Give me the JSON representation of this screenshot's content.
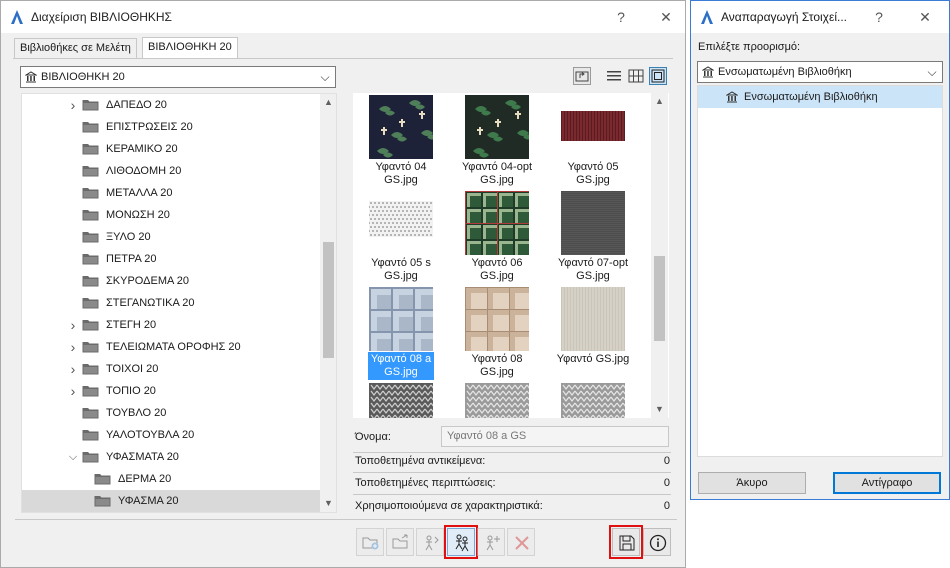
{
  "main_window": {
    "title": "Διαχείριση ΒΙΒΛΙΟΘΗΚΗΣ",
    "help_glyph": "?",
    "close_glyph": "✕",
    "tabs": [
      {
        "label": "Βιβλιοθήκες σε Μελέτη",
        "active": false
      },
      {
        "label": "ΒΙΒΛΙΟΘΗΚΗ 20",
        "active": true
      }
    ],
    "library_select": {
      "value": "ΒΙΒΛΙΟΘΗΚΗ 20",
      "icon": "library-icon"
    },
    "view_buttons": [
      "up-folder-icon",
      "list-view-icon",
      "grid-view-icon",
      "thumbnail-view-icon"
    ],
    "tree": {
      "items": [
        {
          "label": "ΔΑΠΕΔΟ 20",
          "expander": "collapsed",
          "level": 0,
          "selected": false
        },
        {
          "label": "ΕΠΙΣΤΡΩΣΕΙΣ 20",
          "expander": "none",
          "level": 0,
          "selected": false
        },
        {
          "label": "ΚΕΡΑΜΙΚΟ 20",
          "expander": "none",
          "level": 0,
          "selected": false
        },
        {
          "label": "ΛΙΘΟΔΟΜΗ 20",
          "expander": "none",
          "level": 0,
          "selected": false
        },
        {
          "label": "ΜΕΤΑΛΛΑ 20",
          "expander": "none",
          "level": 0,
          "selected": false
        },
        {
          "label": "ΜΟΝΩΣΗ 20",
          "expander": "none",
          "level": 0,
          "selected": false
        },
        {
          "label": "ΞΥΛΟ 20",
          "expander": "none",
          "level": 0,
          "selected": false
        },
        {
          "label": "ΠΕΤΡΑ 20",
          "expander": "none",
          "level": 0,
          "selected": false
        },
        {
          "label": "ΣΚΥΡΟΔΕΜΑ 20",
          "expander": "none",
          "level": 0,
          "selected": false
        },
        {
          "label": "ΣΤΕΓΑΝΩΤΙΚΑ 20",
          "expander": "none",
          "level": 0,
          "selected": false
        },
        {
          "label": "ΣΤΕΓΗ 20",
          "expander": "collapsed",
          "level": 0,
          "selected": false
        },
        {
          "label": "ΤΕΛΕΙΩΜΑΤΑ ΟΡΟΦΗΣ 20",
          "expander": "collapsed",
          "level": 0,
          "selected": false
        },
        {
          "label": "ΤΟΙΧΟΙ 20",
          "expander": "collapsed",
          "level": 0,
          "selected": false
        },
        {
          "label": "ΤΟΠΙΟ 20",
          "expander": "collapsed",
          "level": 0,
          "selected": false
        },
        {
          "label": "ΤΟΥΒΛΟ 20",
          "expander": "none",
          "level": 0,
          "selected": false
        },
        {
          "label": "ΥΑΛΟΤΟΥΒΛΑ 20",
          "expander": "none",
          "level": 0,
          "selected": false
        },
        {
          "label": "ΥΦΑΣΜΑΤΑ 20",
          "expander": "expanded",
          "level": 0,
          "selected": false
        },
        {
          "label": "ΔΕΡΜΑ 20",
          "expander": "none",
          "level": 1,
          "selected": false
        },
        {
          "label": "ΥΦΑΣΜΑ 20",
          "expander": "none",
          "level": 1,
          "selected": true
        }
      ]
    },
    "thumbnails": [
      {
        "line1": "Υφαντό 04",
        "line2": "GS.jpg",
        "texture": "navy-floral",
        "selected": false
      },
      {
        "line1": "Υφαντό 04-opt",
        "line2": "GS.jpg",
        "texture": "green-floral",
        "selected": false
      },
      {
        "line1": "Υφαντό 05",
        "line2": "GS.jpg",
        "texture": "red-weave",
        "selected": false
      },
      {
        "line1": "Υφαντό 05 s",
        "line2": "GS.jpg",
        "texture": "white-dots",
        "selected": false
      },
      {
        "line1": "Υφαντό 06",
        "line2": "GS.jpg",
        "texture": "green-tartan",
        "selected": false
      },
      {
        "line1": "Υφαντό 07-opt",
        "line2": "GS.jpg",
        "texture": "dark-grey",
        "selected": false
      },
      {
        "line1": "Υφαντό 08 a",
        "line2": "GS.jpg",
        "texture": "blue-plaid",
        "selected": true
      },
      {
        "line1": "Υφαντό 08",
        "line2": "GS.jpg",
        "texture": "beige-plaid",
        "selected": false
      },
      {
        "line1": "Υφαντό GS.jpg",
        "line2": "",
        "texture": "light-beige",
        "selected": false
      },
      {
        "line1": "",
        "line2": "",
        "texture": "knit-grey",
        "selected": false
      },
      {
        "line1": "",
        "line2": "",
        "texture": "knit-light",
        "selected": false
      },
      {
        "line1": "",
        "line2": "",
        "texture": "knit-light",
        "selected": false
      }
    ],
    "properties": {
      "name_label": "Όνομα:",
      "name_value": "Υφαντό 08 a GS",
      "placed_objects_label": "Τοποθετημένα αντικείμενα:",
      "placed_objects_value": "0",
      "placed_instances_label": "Τοποθετημένες περιπτώσεις:",
      "placed_instances_value": "0",
      "used_attributes_label": "Χρησιμοποιούμενα σε χαρακτηριστικά:",
      "used_attributes_value": "0"
    },
    "toolbar_icons": [
      "new-folder-icon",
      "open-folder-icon",
      "move-object-icon",
      "duplicate-object-icon",
      "add-object-icon",
      "delete-icon",
      "save-icon",
      "info-icon"
    ],
    "highlight_color": "#e01010"
  },
  "copy_dialog": {
    "title": "Αναπαραγωγή Στοιχεί...",
    "help_glyph": "?",
    "close_glyph": "✕",
    "prompt": "Επιλέξτε προορισμό:",
    "destination_select": "Ενσωματωμένη Βιβλιοθήκη",
    "destination_item": "Ενσωματωμένη Βιβλιοθήκη",
    "cancel_label": "Άκυρο",
    "copy_label": "Αντίγραφο",
    "accent_color": "#0078d7"
  }
}
